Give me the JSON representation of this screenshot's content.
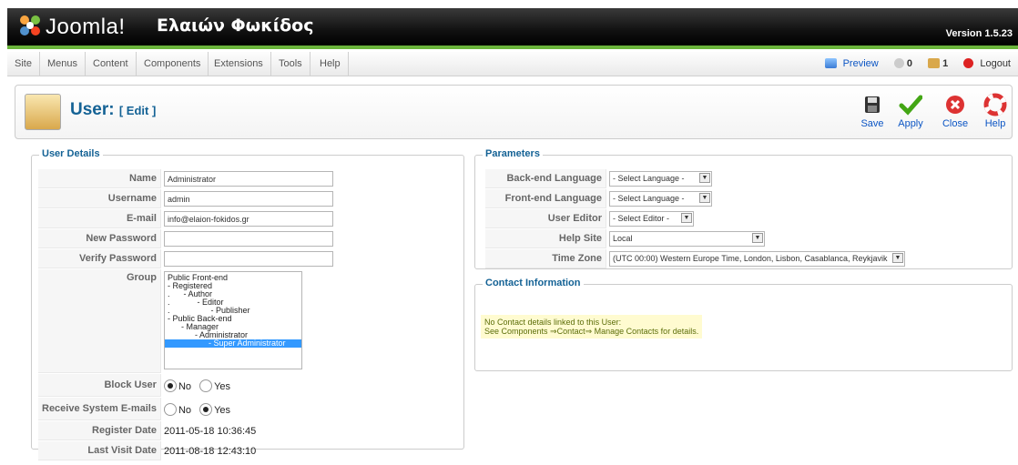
{
  "header": {
    "brand": "Joomla!",
    "site_name": "Ελαιών Φωκίδος",
    "version": "Version 1.5.23"
  },
  "menu": [
    "Site",
    "Menus",
    "Content",
    "Components",
    "Extensions",
    "Tools",
    "Help"
  ],
  "status": {
    "preview": "Preview",
    "messages": "0",
    "users_online": "1",
    "logout": "Logout"
  },
  "toolbar": {
    "title": "User:",
    "subtitle": "[ Edit ]",
    "buttons": [
      "Save",
      "Apply",
      "Close",
      "Help"
    ]
  },
  "user_details": {
    "legend": "User Details",
    "fields": {
      "name_label": "Name",
      "name_value": "Administrator",
      "username_label": "Username",
      "username_value": "admin",
      "email_label": "E-mail",
      "email_value": "info@elaion-fokidos.gr",
      "new_password_label": "New Password",
      "new_password_value": "",
      "verify_password_label": "Verify Password",
      "verify_password_value": "",
      "group_label": "Group",
      "block_user_label": "Block User",
      "receive_emails_label": "Receive System E-mails",
      "register_date_label": "Register Date",
      "register_date_value": "2011-05-18 10:36:45",
      "last_visit_label": "Last Visit Date",
      "last_visit_value": "2011-08-18 12:43:10"
    },
    "group_options": [
      "Public Front-end",
      "- Registered",
      ".      - Author",
      ".            - Editor",
      ".                  - Publisher",
      "- Public Back-end",
      "      - Manager",
      "            - Administrator",
      "                  - Super Administrator"
    ],
    "group_selected": "8",
    "block_user": {
      "no": "No",
      "yes": "Yes",
      "selected": "No"
    },
    "receive_emails": {
      "no": "No",
      "yes": "Yes",
      "selected": "Yes"
    }
  },
  "parameters": {
    "legend": "Parameters",
    "backend_language_label": "Back-end Language",
    "backend_language_value": "- Select Language -",
    "frontend_language_label": "Front-end Language",
    "frontend_language_value": "- Select Language -",
    "user_editor_label": "User Editor",
    "user_editor_value": "- Select Editor -",
    "help_site_label": "Help Site",
    "help_site_value": "Local",
    "time_zone_label": "Time Zone",
    "time_zone_value": "(UTC 00:00) Western Europe Time, London, Lisbon, Casablanca, Reykjavik"
  },
  "contact": {
    "legend": "Contact Information",
    "line1": "No Contact details linked to this User:",
    "line2": "See Components ⇒Contact⇒ Manage Contacts for details."
  },
  "colors": {
    "accent_blue": "#146295",
    "link_blue": "#0b55c4",
    "header_green": "#6ab43a",
    "notice_bg": "#fffbd0"
  }
}
